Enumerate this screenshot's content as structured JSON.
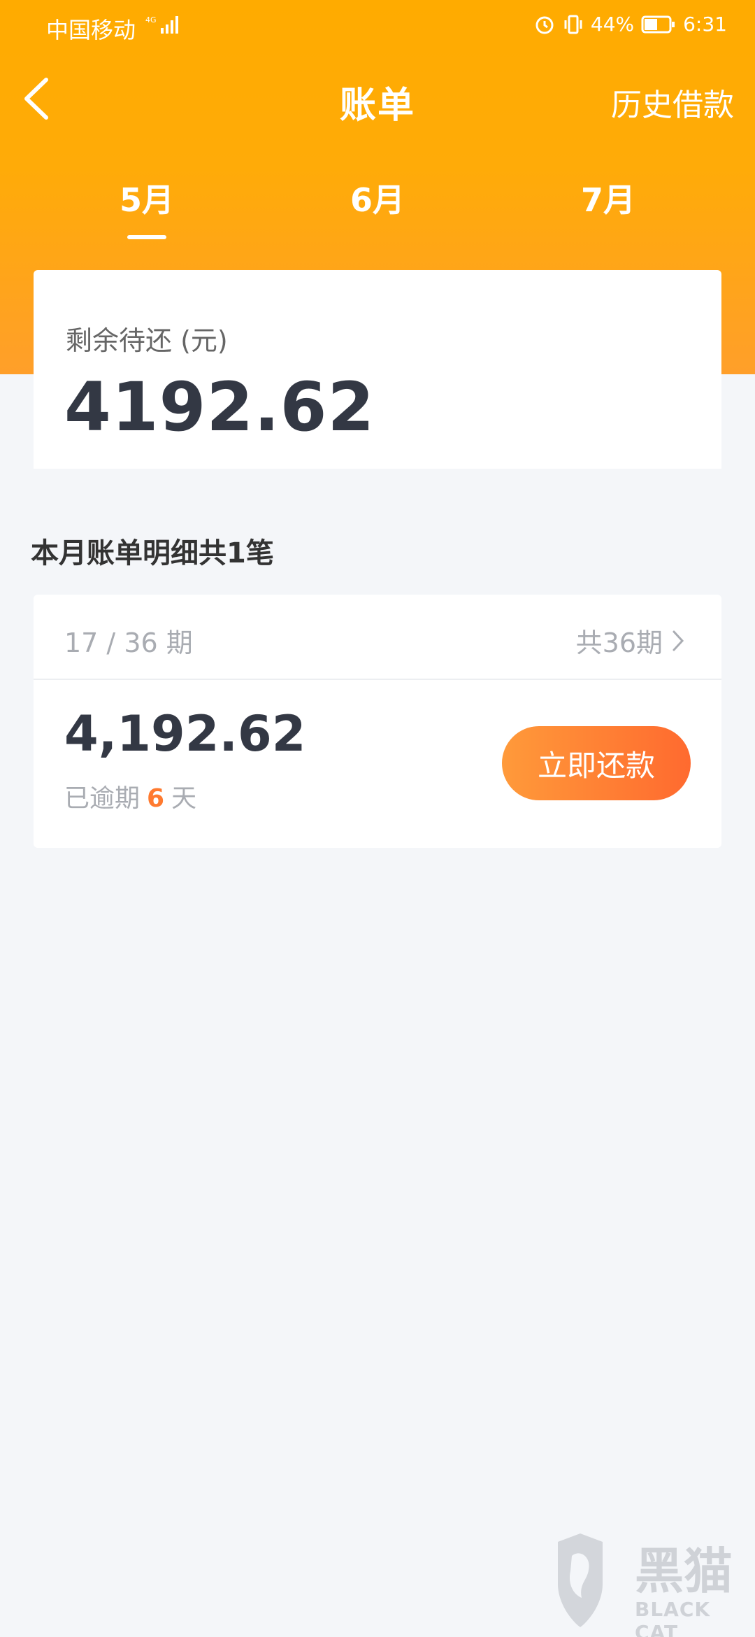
{
  "status_bar": {
    "carrier": "中国移动",
    "network": "4G",
    "battery": "44%",
    "time": "6:31"
  },
  "nav": {
    "title": "账单",
    "history_label": "历史借款"
  },
  "tabs": [
    {
      "label": "5月",
      "selected": true
    },
    {
      "label": "6月",
      "selected": false
    },
    {
      "label": "7月",
      "selected": false
    }
  ],
  "remaining": {
    "label": "剩余待还 (元)",
    "amount": "4192.62"
  },
  "section_title": "本月账单明细共1笔",
  "bill": {
    "period": "17 / 36 期",
    "total_periods": "共36期",
    "amount": "4,192.62",
    "overdue_prefix": "已逾期",
    "overdue_days": "6",
    "overdue_suffix": "天",
    "pay_button": "立即还款"
  },
  "watermark": {
    "cn": "黑猫",
    "en": "BLACK CAT"
  },
  "colors": {
    "header_orange": "#ffab00",
    "button_orange": "#ff6a2f",
    "text_dark": "#333844",
    "text_gray": "#a9acb2"
  }
}
